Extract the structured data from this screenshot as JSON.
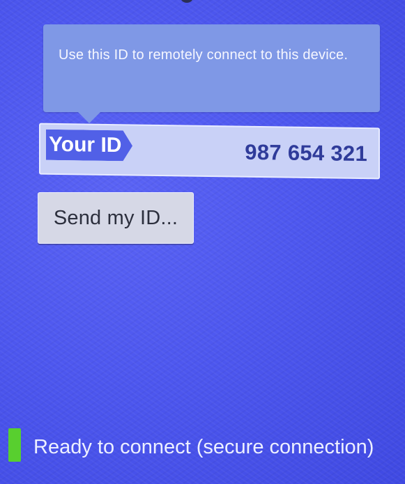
{
  "tooltip": {
    "text": "Use this ID to remotely connect to this device."
  },
  "id_bar": {
    "label": "Your ID",
    "value": "987 654 321"
  },
  "actions": {
    "send_label": "Send my ID..."
  },
  "status": {
    "text": "Ready to connect (secure connection)",
    "indicator_color": "#58cf2f"
  },
  "colors": {
    "background": "#4d57ef",
    "tooltip": "#7f98e6",
    "id_label": "#5160e7",
    "id_value": "#2f3b9a"
  }
}
